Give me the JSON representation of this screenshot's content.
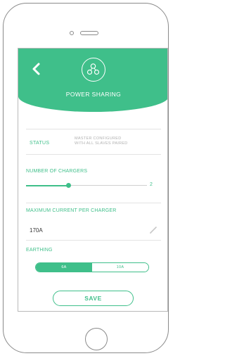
{
  "header": {
    "title": "POWER SHARING",
    "back_icon": "chevron-left-icon",
    "logo_icon": "power-sharing-nodes-icon"
  },
  "status": {
    "label": "STATUS",
    "value_line1": "MASTER CONFIGURED",
    "value_line2": "WITH ALL SLAVES PAIRED"
  },
  "chargers": {
    "label": "NUMBER OF CHARGERS",
    "value": "2",
    "slider_level": 0.35
  },
  "max_current": {
    "label": "MAXIMUM CURRENT PER CHARGER",
    "value": "170A",
    "edit_icon": "pencil-icon"
  },
  "earthing": {
    "label": "EARTHING",
    "options": [
      "6A",
      "10A"
    ],
    "selected": "6A"
  },
  "actions": {
    "save_label": "SAVE"
  },
  "colors": {
    "accent": "#3fbf8a",
    "muted_text": "#b0b0b0",
    "frame": "#8a8a8a"
  }
}
